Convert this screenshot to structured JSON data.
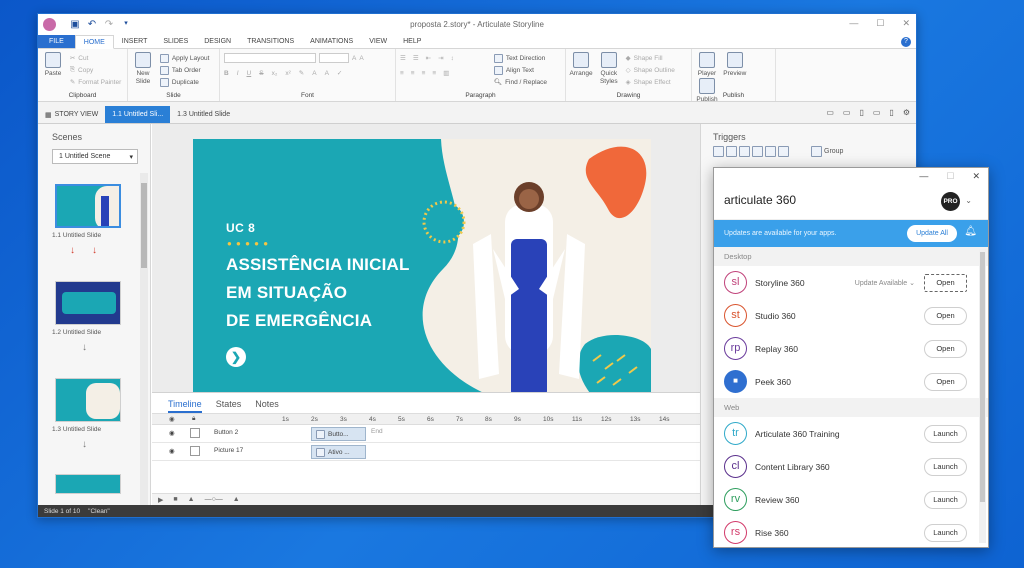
{
  "main_window": {
    "title": "proposta 2.story* - Articulate Storyline",
    "ribbon_tabs": [
      "FILE",
      "HOME",
      "INSERT",
      "SLIDES",
      "DESIGN",
      "TRANSITIONS",
      "ANIMATIONS",
      "VIEW",
      "HELP"
    ],
    "active_tab": "HOME",
    "ribbon": {
      "clipboard": {
        "label": "Clipboard",
        "paste": "Paste",
        "cut": "Cut",
        "copy": "Copy",
        "format_painter": "Format Painter"
      },
      "slide": {
        "label": "Slide",
        "new_slide": "New Slide",
        "apply_layout": "Apply Layout",
        "tab_order": "Tab Order",
        "duplicate": "Duplicate"
      },
      "font": {
        "label": "Font"
      },
      "paragraph": {
        "label": "Paragraph",
        "text_direction": "Text Direction",
        "align_text": "Align Text",
        "find_replace": "Find / Replace"
      },
      "drawing": {
        "label": "Drawing",
        "arrange": "Arrange",
        "quick_styles": "Quick Styles",
        "shape_fill": "Shape Fill",
        "shape_outline": "Shape Outline",
        "shape_effect": "Shape Effect"
      },
      "publish": {
        "label": "Publish",
        "player": "Player",
        "preview": "Preview",
        "publish": "Publish"
      }
    },
    "slide_tabs": [
      {
        "label": "STORY VIEW"
      },
      {
        "label": "1.1 Untitled Sli..."
      },
      {
        "label": "1.3 Untitled Slide"
      }
    ],
    "scenes_panel": {
      "title": "Scenes",
      "scene_select": "1 Untitled Scene",
      "thumbnails": [
        "1.1 Untitled Slide",
        "1.2 Untitled Slide",
        "1.3 Untitled Slide"
      ]
    },
    "slide": {
      "uc": "UC 8",
      "dots": "● ● ● ● ●",
      "title_lines": [
        "ASSISTÊNCIA INICIAL",
        "EM SITUAÇÃO",
        "DE EMERGÊNCIA"
      ],
      "next_glyph": "❯"
    },
    "timeline": {
      "tabs": [
        "Timeline",
        "States",
        "Notes"
      ],
      "ruler": [
        "1s",
        "2s",
        "3s",
        "4s",
        "5s",
        "6s",
        "7s",
        "8s",
        "9s",
        "10s",
        "11s",
        "12s",
        "13s",
        "14s"
      ],
      "rows": [
        {
          "name": "Button 2",
          "chip": "Butto..."
        },
        {
          "name": "Picture 17",
          "chip": "Ativo ..."
        }
      ],
      "end_label": "End"
    },
    "triggers": {
      "title": "Triggers",
      "group_label": "Group"
    },
    "status": {
      "slide_count": "Slide 1 of 10",
      "theme": "\"Clean\""
    }
  },
  "a360": {
    "logo_word": "articulate",
    "logo_num": "360",
    "avatar": "PRO",
    "banner_text": "Updates are available for your apps.",
    "update_all": "Update All",
    "desktop_label": "Desktop",
    "web_label": "Web",
    "desktop_apps": [
      {
        "abbr": "sl",
        "name": "Storyline 360",
        "status": "Update Available ⌄",
        "button": "Open",
        "color": "#c0427a"
      },
      {
        "abbr": "st",
        "name": "Studio 360",
        "status": "",
        "button": "Open",
        "color": "#d9542e"
      },
      {
        "abbr": "rp",
        "name": "Replay 360",
        "status": "",
        "button": "Open",
        "color": "#6a3b9c"
      },
      {
        "abbr": "",
        "name": "Peek 360",
        "status": "",
        "button": "Open",
        "color": "#2f6fd0"
      }
    ],
    "web_apps": [
      {
        "abbr": "tr",
        "name": "Articulate 360 Training",
        "button": "Launch",
        "color": "#2fa9c9"
      },
      {
        "abbr": "cl",
        "name": "Content Library 360",
        "button": "Launch",
        "color": "#5a2f8c"
      },
      {
        "abbr": "rv",
        "name": "Review 360",
        "button": "Launch",
        "color": "#2e9e5e"
      },
      {
        "abbr": "rs",
        "name": "Rise 360",
        "button": "Launch",
        "color": "#d23a6a"
      }
    ]
  }
}
